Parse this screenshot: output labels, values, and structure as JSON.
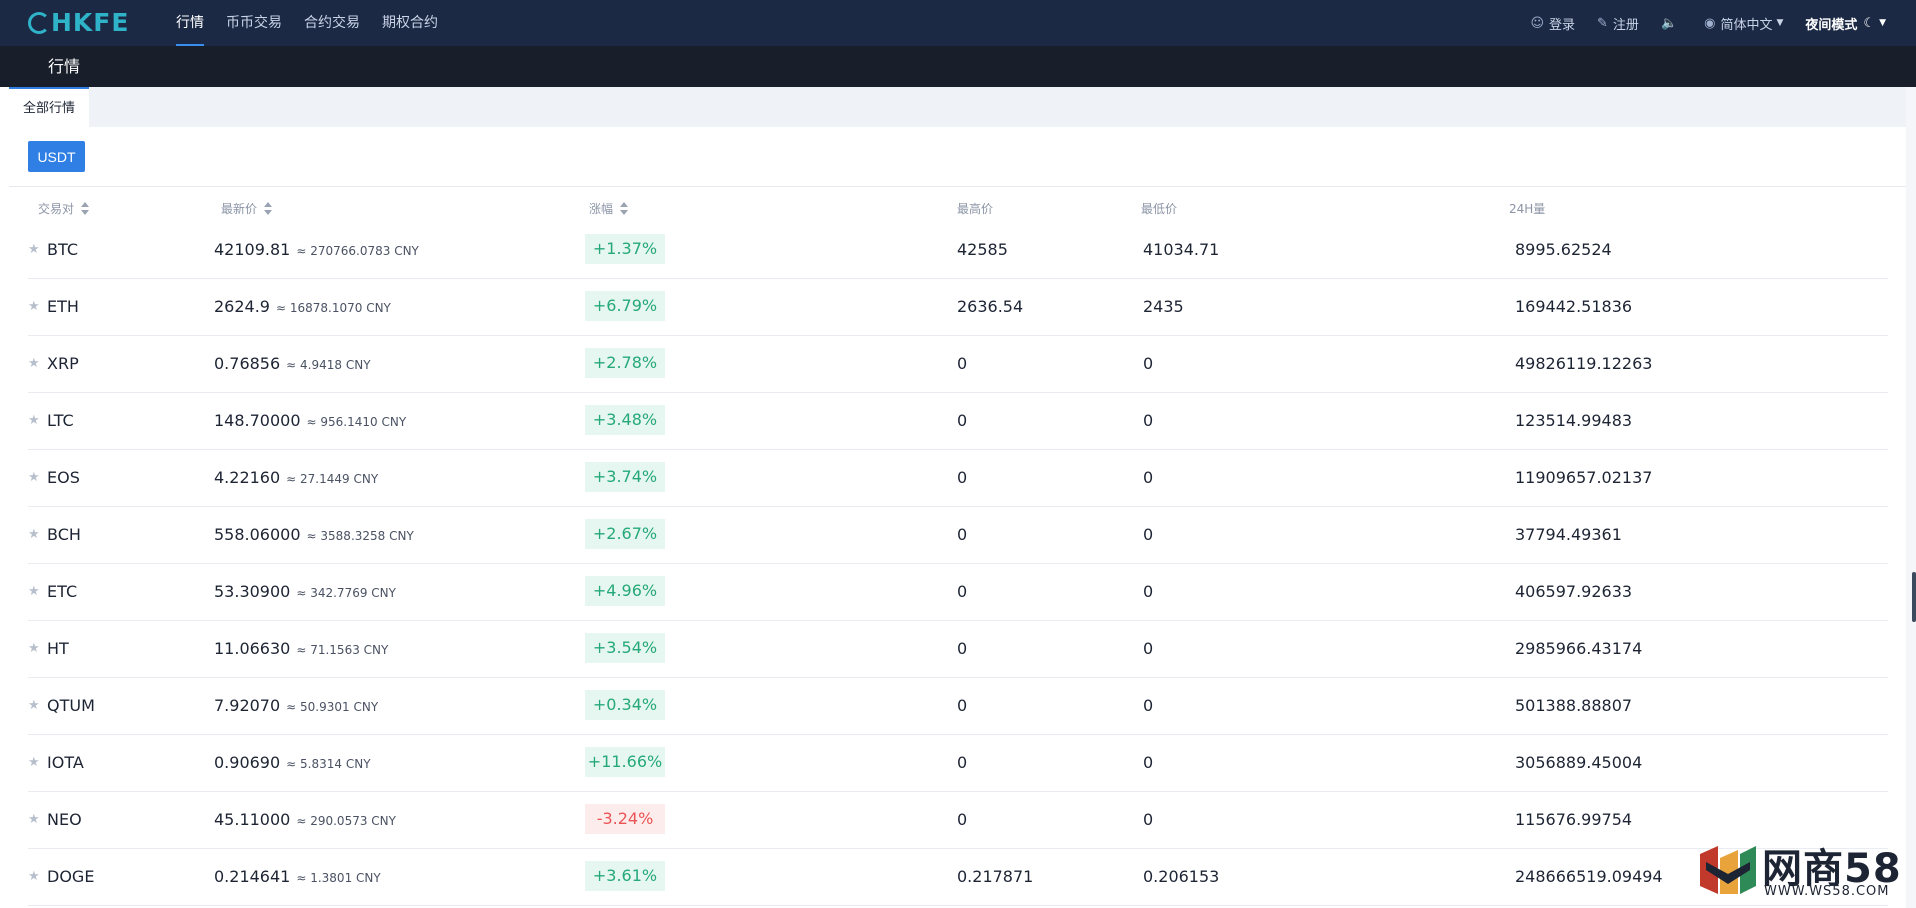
{
  "nav": {
    "logo_text": "HKFE",
    "links": [
      {
        "label": "行情"
      },
      {
        "label": "币币交易"
      },
      {
        "label": "合约交易"
      },
      {
        "label": "期权合约"
      }
    ],
    "login": "登录",
    "register": "注册",
    "language": "简体中文",
    "night_mode": "夜间模式"
  },
  "page_title": "行情",
  "tabs": [
    {
      "label": "全部行情"
    }
  ],
  "quote_button": "USDT",
  "table": {
    "headers": {
      "pair": "交易对",
      "price": "最新价",
      "change": "涨幅",
      "high": "最高价",
      "low": "最低价",
      "volume": "24H量"
    },
    "rows": [
      {
        "pair": "BTC",
        "price": "42109.81",
        "cny": "≈ 270766.0783 CNY",
        "change": "+1.37%",
        "high": "42585",
        "low": "41034.71",
        "volume": "8995.62524"
      },
      {
        "pair": "ETH",
        "price": "2624.9",
        "cny": "≈ 16878.1070 CNY",
        "change": "+6.79%",
        "high": "2636.54",
        "low": "2435",
        "volume": "169442.51836"
      },
      {
        "pair": "XRP",
        "price": "0.76856",
        "cny": "≈ 4.9418 CNY",
        "change": "+2.78%",
        "high": "0",
        "low": "0",
        "volume": "49826119.12263"
      },
      {
        "pair": "LTC",
        "price": "148.70000",
        "cny": "≈ 956.1410 CNY",
        "change": "+3.48%",
        "high": "0",
        "low": "0",
        "volume": "123514.99483"
      },
      {
        "pair": "EOS",
        "price": "4.22160",
        "cny": "≈ 27.1449 CNY",
        "change": "+3.74%",
        "high": "0",
        "low": "0",
        "volume": "11909657.02137"
      },
      {
        "pair": "BCH",
        "price": "558.06000",
        "cny": "≈ 3588.3258 CNY",
        "change": "+2.67%",
        "high": "0",
        "low": "0",
        "volume": "37794.49361"
      },
      {
        "pair": "ETC",
        "price": "53.30900",
        "cny": "≈ 342.7769 CNY",
        "change": "+4.96%",
        "high": "0",
        "low": "0",
        "volume": "406597.92633"
      },
      {
        "pair": "HT",
        "price": "11.06630",
        "cny": "≈ 71.1563 CNY",
        "change": "+3.54%",
        "high": "0",
        "low": "0",
        "volume": "2985966.43174"
      },
      {
        "pair": "QTUM",
        "price": "7.92070",
        "cny": "≈ 50.9301 CNY",
        "change": "+0.34%",
        "high": "0",
        "low": "0",
        "volume": "501388.88807"
      },
      {
        "pair": "IOTA",
        "price": "0.90690",
        "cny": "≈ 5.8314 CNY",
        "change": "+11.66%",
        "high": "0",
        "low": "0",
        "volume": "3056889.45004"
      },
      {
        "pair": "NEO",
        "price": "45.11000",
        "cny": "≈ 290.0573 CNY",
        "change": "-3.24%",
        "high": "0",
        "low": "0",
        "volume": "115676.99754"
      },
      {
        "pair": "DOGE",
        "price": "0.214641",
        "cny": "≈ 1.3801 CNY",
        "change": "+3.61%",
        "high": "0.217871",
        "low": "0.206153",
        "volume": "248666519.09494"
      }
    ]
  },
  "watermark": {
    "text": "网商58",
    "url": "WWW.WS58.COM"
  },
  "colors": {
    "nav_bg": "#1b2945",
    "subheader_bg": "#181f2b",
    "accent": "#2f7fe5",
    "up": "#25a97a",
    "down": "#ea5455"
  }
}
